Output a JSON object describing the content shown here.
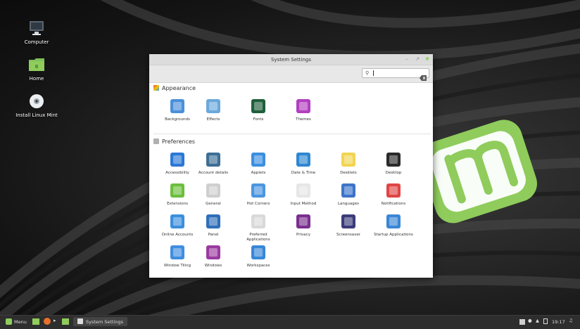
{
  "desktop": {
    "icons": [
      {
        "label": "Computer",
        "icon": "computer-icon"
      },
      {
        "label": "Home",
        "icon": "home-folder-icon"
      },
      {
        "label": "Install Linux Mint",
        "icon": "disc-icon"
      }
    ]
  },
  "window": {
    "title": "System Settings",
    "search": {
      "value": "",
      "placeholder": ""
    },
    "sections": [
      {
        "label": "Appearance",
        "items": [
          {
            "label": "Backgrounds",
            "icon": "backgrounds-icon",
            "color": "#4a90d9"
          },
          {
            "label": "Effects",
            "icon": "effects-icon",
            "color": "#6aa8dc"
          },
          {
            "label": "Fonts",
            "icon": "fonts-icon",
            "color": "#1f5f3c"
          },
          {
            "label": "Themes",
            "icon": "themes-icon",
            "color": "#b23fc0"
          }
        ]
      },
      {
        "label": "Preferences",
        "items": [
          {
            "label": "Accessibility",
            "icon": "accessibility-icon",
            "color": "#2b78d6"
          },
          {
            "label": "Account details",
            "icon": "account-details-icon",
            "color": "#3d6f95"
          },
          {
            "label": "Applets",
            "icon": "applets-icon",
            "color": "#3c8fe0"
          },
          {
            "label": "Date & Time",
            "icon": "clock-icon",
            "color": "#2f87d1"
          },
          {
            "label": "Desklets",
            "icon": "desklets-icon",
            "color": "#f2d451"
          },
          {
            "label": "Desktop",
            "icon": "desktop-icon",
            "color": "#2a2a2a"
          },
          {
            "label": "Extensions",
            "icon": "extensions-icon",
            "color": "#6cbf3c"
          },
          {
            "label": "General",
            "icon": "general-icon",
            "color": "#cfcfcf"
          },
          {
            "label": "Hot Corners",
            "icon": "hot-corners-icon",
            "color": "#4a96e0"
          },
          {
            "label": "Input Method",
            "icon": "input-method-icon",
            "color": "#e6e6e6"
          },
          {
            "label": "Languages",
            "icon": "languages-icon",
            "color": "#3d74c9"
          },
          {
            "label": "Notifications",
            "icon": "notifications-icon",
            "color": "#e04545"
          },
          {
            "label": "Online Accounts",
            "icon": "online-accounts-icon",
            "color": "#3b8fde"
          },
          {
            "label": "Panel",
            "icon": "panel-icon",
            "color": "#2f6fb8"
          },
          {
            "label": "Preferred Applications",
            "icon": "preferred-applications-icon",
            "color": "#d9d9d9"
          },
          {
            "label": "Privacy",
            "icon": "privacy-icon",
            "color": "#7a2f8f"
          },
          {
            "label": "Screensaver",
            "icon": "screensaver-icon",
            "color": "#3b3b7a"
          },
          {
            "label": "Startup Applications",
            "icon": "startup-applications-icon",
            "color": "#3a86d6"
          },
          {
            "label": "Window Tiling",
            "icon": "window-tiling-icon",
            "color": "#3f8ee0"
          },
          {
            "label": "Windows",
            "icon": "windows-icon",
            "color": "#9b3aa0"
          },
          {
            "label": "Workspaces",
            "icon": "workspaces-icon",
            "color": "#3888d8"
          }
        ]
      }
    ]
  },
  "panel": {
    "menu_label": "Menu",
    "task_label": "System Settings",
    "clock": "19:17",
    "accent": "#8fcc5c"
  }
}
